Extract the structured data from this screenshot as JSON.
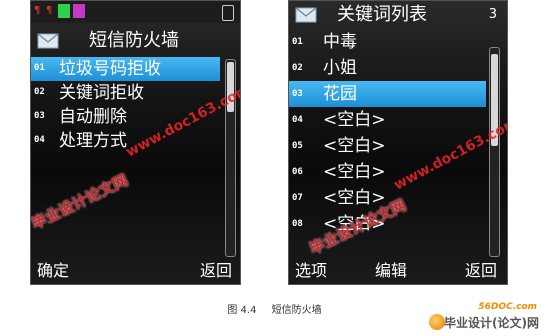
{
  "left_screen": {
    "title": "短信防火墙",
    "menu": [
      {
        "num": "01",
        "label": "垃圾号码拒收"
      },
      {
        "num": "02",
        "label": "关键词拒收"
      },
      {
        "num": "03",
        "label": "自动删除"
      },
      {
        "num": "04",
        "label": "处理方式"
      }
    ],
    "selected_index": 0,
    "softkey_left": "确定",
    "softkey_right": "返回"
  },
  "right_screen": {
    "title": "关键词列表",
    "count": "3",
    "items": [
      {
        "num": "01",
        "label": "中毒"
      },
      {
        "num": "02",
        "label": "小姐"
      },
      {
        "num": "03",
        "label": "花园"
      },
      {
        "num": "04",
        "label": "<空白>"
      },
      {
        "num": "05",
        "label": "<空白>"
      },
      {
        "num": "06",
        "label": "<空白>"
      },
      {
        "num": "07",
        "label": "<空白>"
      },
      {
        "num": "08",
        "label": "<空白>"
      }
    ],
    "selected_index": 2,
    "softkey_left": "选项",
    "softkey_middle": "编辑",
    "softkey_right": "返回"
  },
  "watermarks": {
    "site": "www.doc163.com",
    "brand": "毕业设计论文网"
  },
  "caption": {
    "figure": "图 4.4",
    "text": "短信防火墙"
  },
  "footer_logo": {
    "site": "56DOC.com",
    "brand": "毕业设计(论文)网"
  },
  "colors": {
    "selection": "#2b9ae0",
    "watermark": "#e8242a",
    "background": "#0f0f0f"
  }
}
